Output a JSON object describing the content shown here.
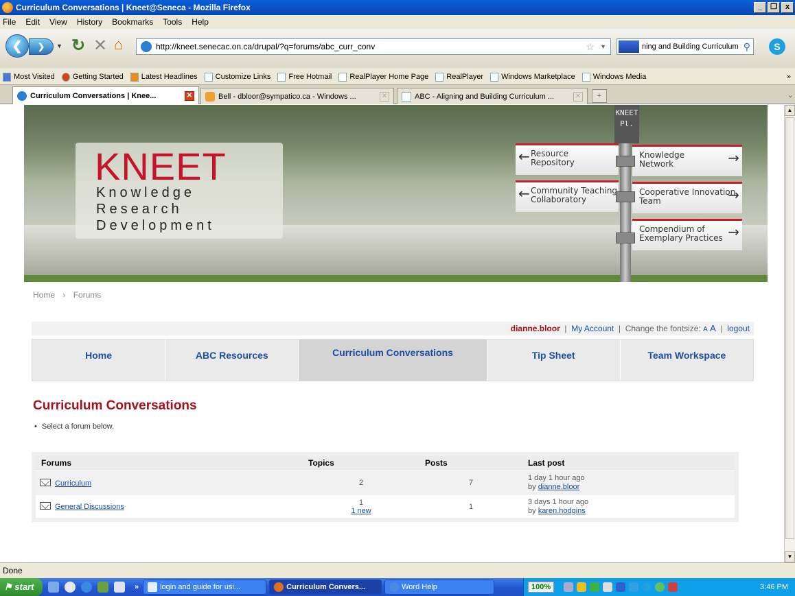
{
  "window": {
    "title": "Curriculum Conversations | Kneet@Seneca - Mozilla Firefox",
    "controls": [
      "_",
      "❐",
      "x"
    ]
  },
  "menu": [
    "File",
    "Edit",
    "View",
    "History",
    "Bookmarks",
    "Tools",
    "Help"
  ],
  "toolbar": {
    "url": "http://kneet.senecac.on.ca/drupal/?q=forums/abc_curr_conv",
    "search": "ning and Building Curriculum"
  },
  "bookmarks": [
    "Most Visited",
    "Getting Started",
    "Latest Headlines",
    "Customize Links",
    "Free Hotmail",
    "RealPlayer Home Page",
    "RealPlayer",
    "Windows Marketplace",
    "Windows Media"
  ],
  "tabs": [
    {
      "label": "Curriculum Conversations | Knee..."
    },
    {
      "label": "Bell - dbloor@sympatico.ca - Windows ..."
    },
    {
      "label": "ABC - Aligning and Building Curriculum ..."
    }
  ],
  "banner": {
    "logo_title": "KNEET",
    "logo_lines": [
      "Knowledge",
      "Research",
      "Development"
    ],
    "pole_label": [
      "KNEET",
      "Pl."
    ],
    "signs": {
      "resource": "Resource\nRepository",
      "community": "Community Teaching\nCollaboratory",
      "knowledge": "Knowledge\nNetwork",
      "cooperative": "Cooperative Innovation\nTeam",
      "compendium": "Compendium of\nExemplary Practices"
    }
  },
  "breadcrumb": {
    "home": "Home",
    "sep": "›",
    "current": "Forums"
  },
  "userbar": {
    "username": "dianne.bloor",
    "my_account": "My Account",
    "fontsize_label": "Change the fontsize:",
    "fs_small": "A",
    "fs_big": "A",
    "logout": "logout",
    "divider": "|"
  },
  "primary_nav": [
    {
      "label": "Home"
    },
    {
      "label": "ABC Resources"
    },
    {
      "label": "Curriculum Conversations"
    },
    {
      "label": "Tip Sheet"
    },
    {
      "label": "Team Workspace"
    }
  ],
  "page": {
    "title": "Curriculum Conversations",
    "intro": "Select a forum below."
  },
  "forum_table": {
    "headers": {
      "forums": "Forums",
      "topics": "Topics",
      "posts": "Posts",
      "last_post": "Last post"
    },
    "rows": [
      {
        "name": "Curriculum",
        "topics": "2",
        "new": "",
        "posts": "7",
        "last_time": "1 day 1 hour ago",
        "by": "by",
        "last_user": "dianne.bloor"
      },
      {
        "name": "General Discussions",
        "topics": "1",
        "new": "1 new",
        "posts": "1",
        "last_time": "3 days 1 hour ago",
        "by": "by",
        "last_user": "karen.hodgins"
      }
    ]
  },
  "status": "Done",
  "taskbar": {
    "start": "start",
    "chevron": "»",
    "buttons": [
      "login and guide for usi...",
      "Curriculum Convers...",
      "Word Help"
    ],
    "zoom": "100%",
    "clock": "3:46 PM"
  },
  "colors": {
    "brand_red": "#a4101e",
    "link_blue": "#1a4ea0",
    "xp_blue": "#2458d0"
  }
}
